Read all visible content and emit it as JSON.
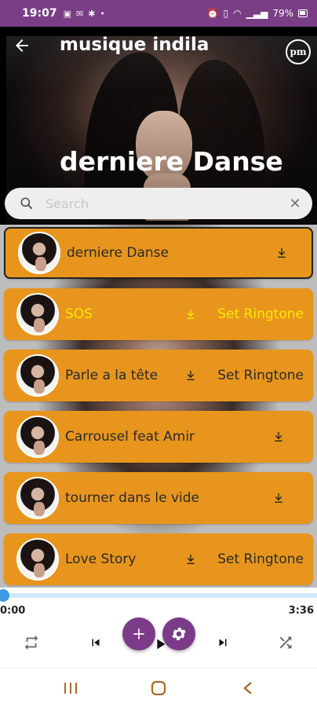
{
  "status_bar": {
    "time": "19:07",
    "battery": "79%"
  },
  "app": {
    "title": "musique indila",
    "badge": "pm",
    "now_playing": "derniere Danse"
  },
  "search": {
    "placeholder": "Search"
  },
  "songs": [
    {
      "title": "derniere Danse",
      "ringtone": ""
    },
    {
      "title": "SOS",
      "ringtone": "Set Ringtone"
    },
    {
      "title": "Parle a la tête",
      "ringtone": "Set Ringtone"
    },
    {
      "title": "Carrousel feat Amir",
      "ringtone": ""
    },
    {
      "title": "tourner dans le vide",
      "ringtone": ""
    },
    {
      "title": "Love Story",
      "ringtone": "Set Ringtone"
    }
  ],
  "player": {
    "position": "0:00",
    "duration": "3:36",
    "progress": 0.0
  },
  "colors": {
    "accent": "#7b3b88",
    "row": "#e8951d",
    "highlight": "#ffea00",
    "progress": "#4aa3e0"
  }
}
